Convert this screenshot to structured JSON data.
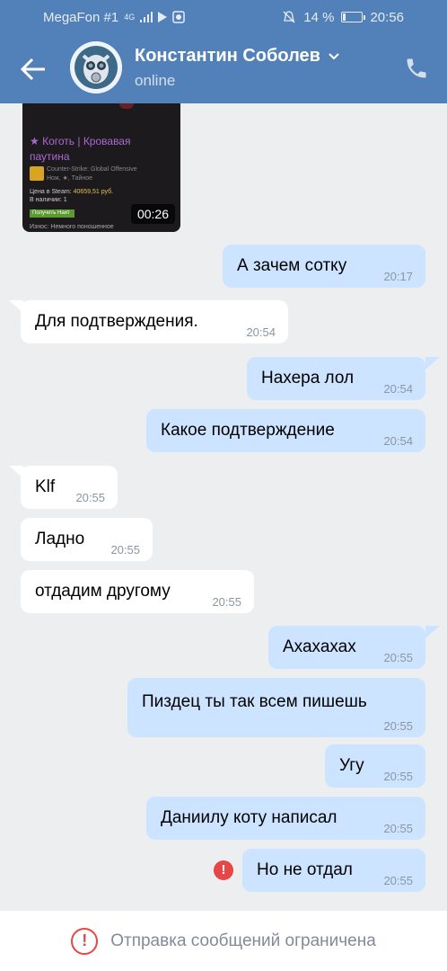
{
  "statusbar": {
    "carrier": "MegaFon #1",
    "network": "4G",
    "battery": "14 %",
    "time": "20:56"
  },
  "header": {
    "contact_name": "Константин Соболев",
    "contact_status": "online",
    "icons": [
      "back-arrow-icon",
      "avatar",
      "chevron-down-icon",
      "phone-icon"
    ]
  },
  "video": {
    "title": "★ Коготь | Кровавая паутина",
    "game": "Counter-Strike: Global Offensive",
    "item_type": "Нож, ★, Тайное",
    "price_label": "Цена в Steam:",
    "price_value": "40659,51 руб.",
    "stock": "В наличии: 1",
    "button": "Получить Наит",
    "wear": "Износ: Немного поношенное",
    "duration": "00:26"
  },
  "messages": [
    {
      "dir": "out",
      "text": "А зачем сотку",
      "time": "20:17"
    },
    {
      "dir": "in",
      "text": "Для подтверждения.",
      "time": "20:54"
    },
    {
      "dir": "out",
      "text": "Нахера лол",
      "time": "20:54"
    },
    {
      "dir": "out",
      "text": "Какое подтверждение",
      "time": "20:54"
    },
    {
      "dir": "in",
      "text": "Klf",
      "time": "20:55"
    },
    {
      "dir": "in",
      "text": "Ладно",
      "time": "20:55"
    },
    {
      "dir": "in",
      "text": "отдадим другому",
      "time": "20:55"
    },
    {
      "dir": "out",
      "text": "Ахахахах",
      "time": "20:55"
    },
    {
      "dir": "out",
      "text": "Пиздец ты так всем пишешь",
      "time": "20:55"
    },
    {
      "dir": "out",
      "text": "Угу",
      "time": "20:55"
    },
    {
      "dir": "out",
      "text": "Даниилу коту написал",
      "time": "20:55"
    },
    {
      "dir": "out",
      "text": "Но не отдал",
      "time": "20:55",
      "failed": true
    }
  ],
  "bottom": {
    "notice": "Отправка сообщений ограничена"
  },
  "colors": {
    "header": "#5181b8",
    "outgoing_bubble": "#cce4ff",
    "incoming_bubble": "#ffffff",
    "background": "#edeef0",
    "error": "#e64646"
  }
}
